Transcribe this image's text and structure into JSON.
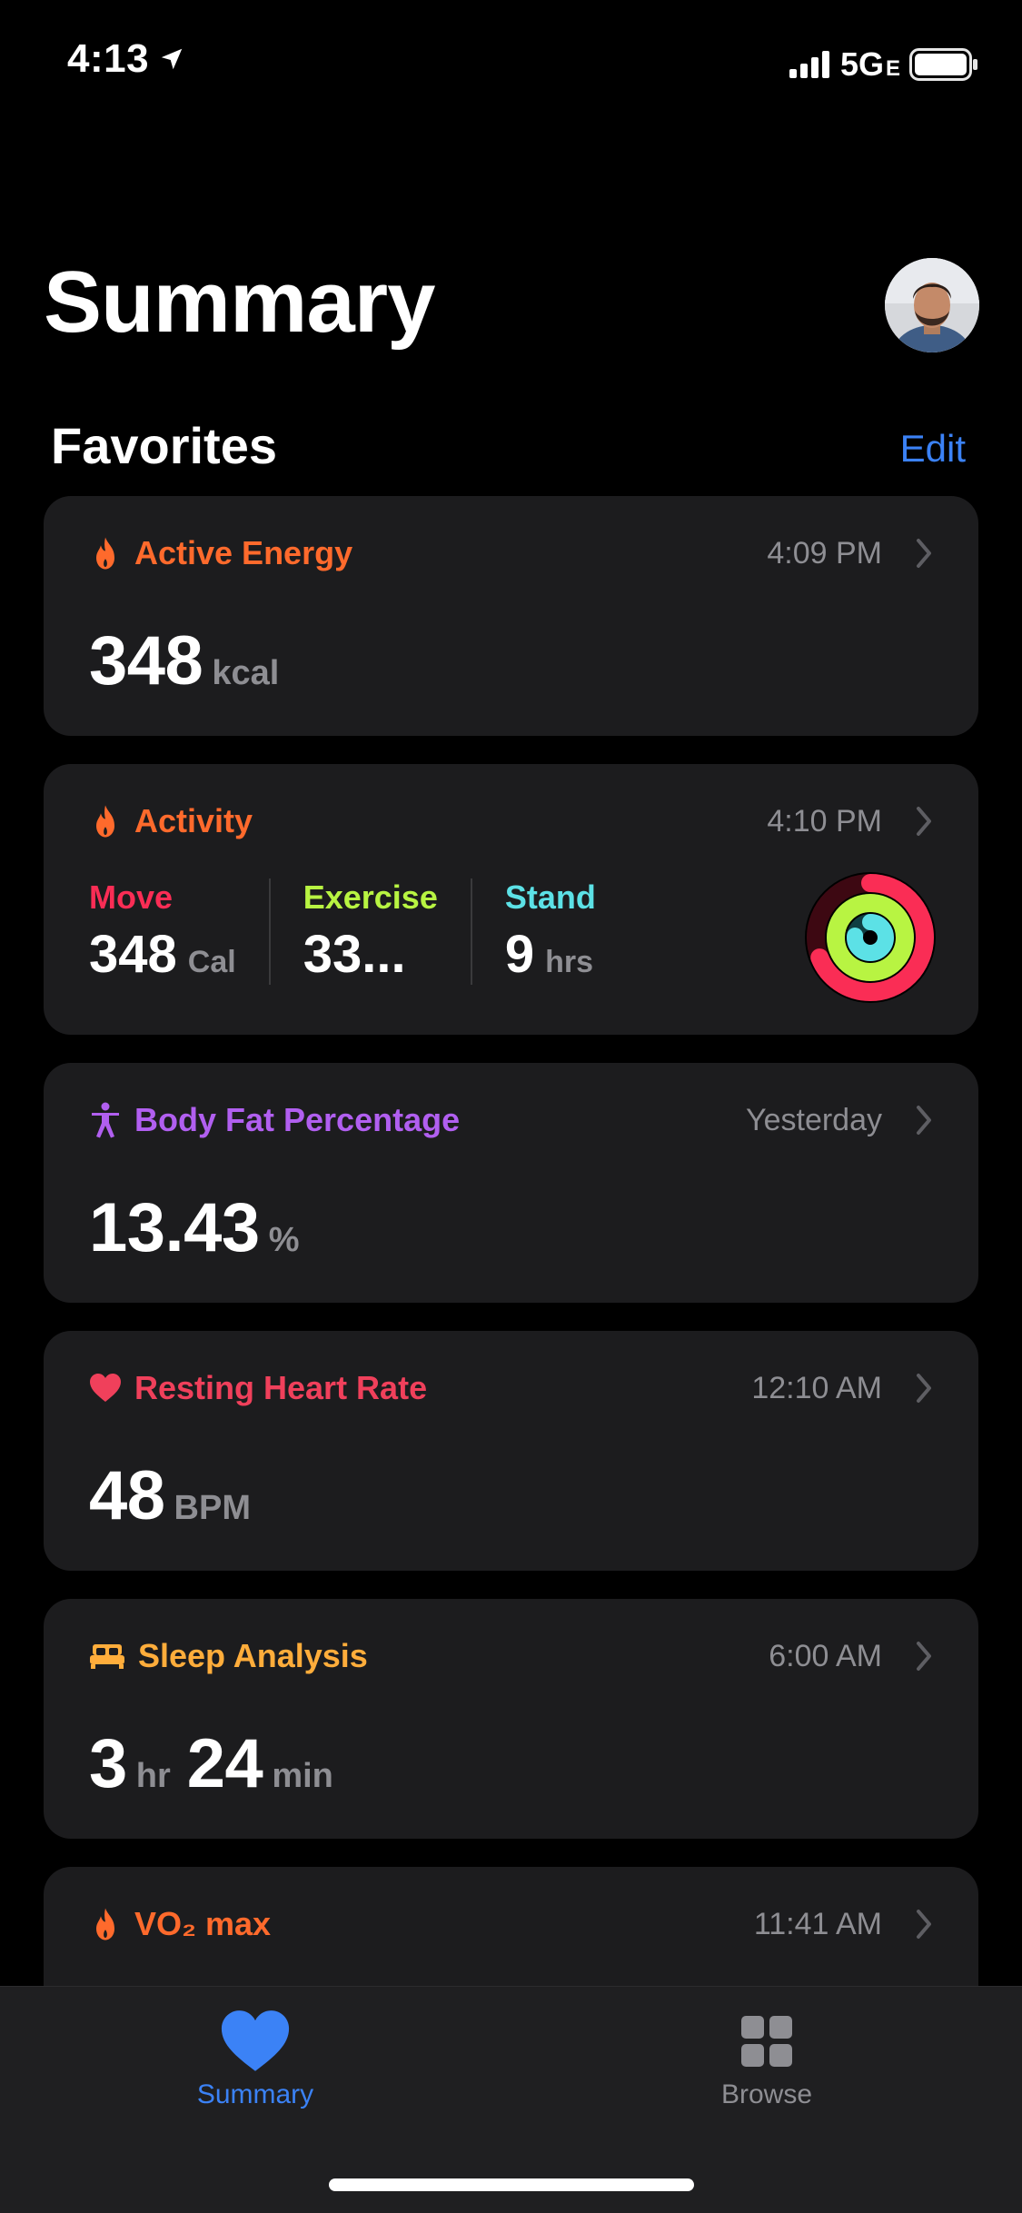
{
  "status_bar": {
    "time": "4:13",
    "network": "5G",
    "network_sub": "E"
  },
  "header": {
    "title": "Summary"
  },
  "favorites": {
    "title": "Favorites",
    "edit_label": "Edit"
  },
  "cards": {
    "active_energy": {
      "label": "Active Energy",
      "time": "4:09 PM",
      "value": "348",
      "unit": "kcal"
    },
    "activity": {
      "label": "Activity",
      "time": "4:10 PM",
      "move": {
        "label": "Move",
        "value": "348",
        "unit": "Cal"
      },
      "exercise": {
        "label": "Exercise",
        "value": "33..."
      },
      "stand": {
        "label": "Stand",
        "value": "9",
        "unit": "hrs"
      }
    },
    "body_fat": {
      "label": "Body Fat Percentage",
      "time": "Yesterday",
      "value": "13.43",
      "unit": "%"
    },
    "resting_hr": {
      "label": "Resting Heart Rate",
      "time": "12:10 AM",
      "value": "48",
      "unit": "BPM"
    },
    "sleep": {
      "label": "Sleep Analysis",
      "time": "6:00 AM",
      "hours": "3",
      "hours_unit": "hr",
      "minutes": "24",
      "minutes_unit": "min"
    },
    "vo2": {
      "label": "VO₂ max",
      "time": "11:41 AM"
    }
  },
  "tabs": {
    "summary": "Summary",
    "browse": "Browse"
  },
  "colors": {
    "energy": "#ff6a2c",
    "move": "#fa2d55",
    "exercise": "#b8f442",
    "stand": "#5ce1e6",
    "body": "#b15ff0",
    "heart": "#f0405b",
    "sleep": "#ffad3b",
    "accent": "#3b82f6"
  }
}
